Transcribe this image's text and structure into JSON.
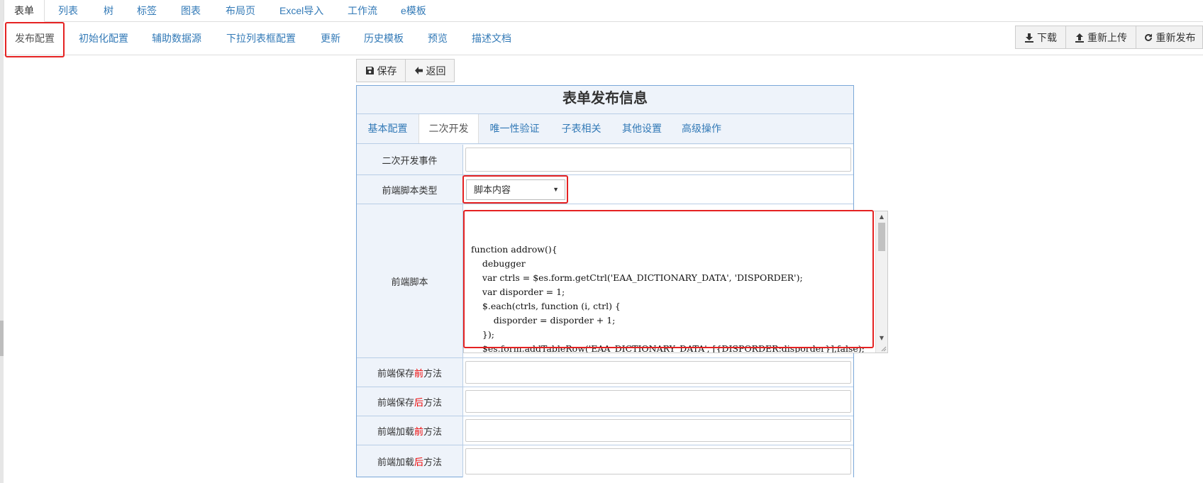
{
  "top_menu": [
    "表单",
    "列表",
    "树",
    "标签",
    "图表",
    "布局页",
    "Excel导入",
    "工作流",
    "e模板"
  ],
  "sub_menu": [
    "发布配置",
    "初始化配置",
    "辅助数据源",
    "下拉列表框配置",
    "更新",
    "历史模板",
    "预览",
    "描述文档"
  ],
  "right_buttons": {
    "download": "下载",
    "reupload": "重新上传",
    "republish": "重新发布"
  },
  "toolbar": {
    "save": "保存",
    "back": "返回"
  },
  "panel": {
    "title": "表单发布信息",
    "tabs": [
      "基本配置",
      "二次开发",
      "唯一性验证",
      "子表相关",
      "其他设置",
      "高级操作"
    ],
    "active_tab": "二次开发"
  },
  "fields": {
    "dev_event_label": "二次开发事件",
    "script_type_label": "前端脚本类型",
    "script_type_value": "脚本内容",
    "script_label": "前端脚本",
    "script_code": "function addrow(){\n    debugger\n    var ctrls = $es.form.getCtrl('EAA_DICTIONARY_DATA', 'DISPORDER');\n    var disporder = 1;\n    $.each(ctrls, function (i, ctrl) {\n        disporder = disporder + 1;\n    });\n    $es.form.addTableRow('EAA_DICTIONARY_DATA', [{DISPORDER:disporder}],false);\n}",
    "before_save": {
      "pre": "前端保存",
      "hl": "前",
      "post": "方法"
    },
    "after_save": {
      "pre": "前端保存",
      "hl": "后",
      "post": "方法"
    },
    "before_load": {
      "pre": "前端加载",
      "hl": "前",
      "post": "方法"
    },
    "after_load": {
      "pre": "前端加载",
      "hl": "后",
      "post": "方法"
    }
  },
  "colors": {
    "link": "#337ab7",
    "highlight": "#e52222",
    "panel_bg": "#eef3fa",
    "panel_border": "#7aa7d8"
  }
}
